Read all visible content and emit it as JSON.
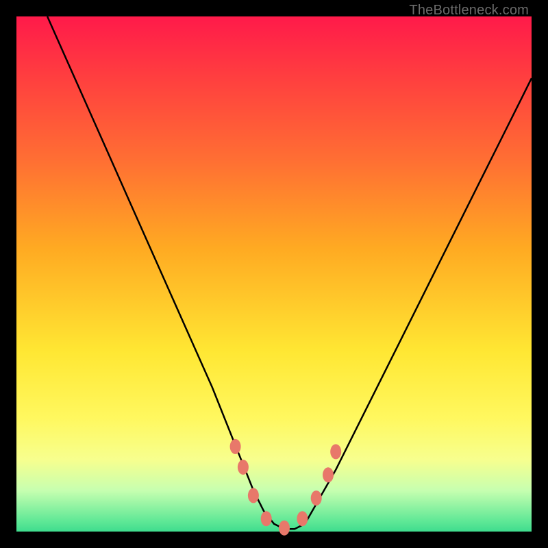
{
  "watermark": "TheBottleneck.com",
  "chart_data": {
    "type": "line",
    "title": "",
    "xlabel": "",
    "ylabel": "",
    "xlim": [
      0,
      100
    ],
    "ylim": [
      0,
      100
    ],
    "series": [
      {
        "name": "bottleneck-curve",
        "x": [
          6,
          10,
          14,
          18,
          22,
          26,
          30,
          34,
          38,
          42,
          44,
          46,
          48,
          50,
          52,
          54,
          56,
          58,
          62,
          66,
          70,
          74,
          78,
          82,
          86,
          90,
          94,
          98,
          100
        ],
        "y": [
          100,
          91,
          82,
          73,
          64,
          55,
          46,
          37,
          28,
          18,
          13,
          8,
          4,
          1.5,
          0.5,
          0.5,
          1.5,
          5,
          12,
          20,
          28,
          36,
          44,
          52,
          60,
          68,
          76,
          84,
          88
        ]
      }
    ],
    "markers": {
      "name": "threshold-markers",
      "points": [
        {
          "x": 42.5,
          "y": 16.5
        },
        {
          "x": 44.0,
          "y": 12.5
        },
        {
          "x": 46.0,
          "y": 7.0
        },
        {
          "x": 48.5,
          "y": 2.5
        },
        {
          "x": 52.0,
          "y": 0.7
        },
        {
          "x": 55.5,
          "y": 2.5
        },
        {
          "x": 58.2,
          "y": 6.5
        },
        {
          "x": 60.5,
          "y": 11.0
        },
        {
          "x": 62.0,
          "y": 15.5
        }
      ]
    },
    "gradient_stops": [
      {
        "pos": 0,
        "color": "#ff1a4a"
      },
      {
        "pos": 50,
        "color": "#ffe733"
      },
      {
        "pos": 100,
        "color": "#3fdc8e"
      }
    ]
  }
}
